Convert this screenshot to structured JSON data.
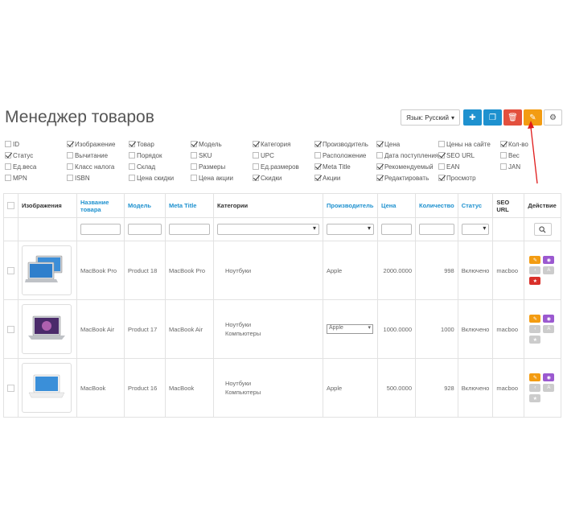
{
  "page": {
    "title": "Менеджер товаров"
  },
  "toolbar": {
    "language_label": "Язык: Русский"
  },
  "columns_options": [
    [
      {
        "label": "ID",
        "checked": false
      },
      {
        "label": "Изображение",
        "checked": true
      },
      {
        "label": "Товар",
        "checked": true
      },
      {
        "label": "Модель",
        "checked": true
      },
      {
        "label": "Категория",
        "checked": true
      },
      {
        "label": "Производитель",
        "checked": true
      },
      {
        "label": "Цена",
        "checked": true
      },
      {
        "label": "Цены на сайте",
        "checked": false
      },
      {
        "label": "Кол-во",
        "checked": true
      }
    ],
    [
      {
        "label": "Статус",
        "checked": true
      },
      {
        "label": "Вычитание",
        "checked": false
      },
      {
        "label": "Порядок",
        "checked": false
      },
      {
        "label": "SKU",
        "checked": false
      },
      {
        "label": "UPC",
        "checked": false
      },
      {
        "label": "Расположение",
        "checked": false
      },
      {
        "label": "Дата поступления",
        "checked": false
      },
      {
        "label": "SEO URL",
        "checked": true
      },
      {
        "label": "Вес",
        "checked": false
      }
    ],
    [
      {
        "label": "Ед.веса",
        "checked": false
      },
      {
        "label": "Класс налога",
        "checked": false
      },
      {
        "label": "Склад",
        "checked": false
      },
      {
        "label": "Размеры",
        "checked": false
      },
      {
        "label": "Ед.размеров",
        "checked": false
      },
      {
        "label": "Meta Title",
        "checked": true
      },
      {
        "label": "Рекомендуемый",
        "checked": true
      },
      {
        "label": "EAN",
        "checked": false
      },
      {
        "label": "JAN",
        "checked": false
      }
    ],
    [
      {
        "label": "MPN",
        "checked": false
      },
      {
        "label": "ISBN",
        "checked": false
      },
      {
        "label": "Цена скидки",
        "checked": false
      },
      {
        "label": "Цена акции",
        "checked": false
      },
      {
        "label": "Скидки",
        "checked": true
      },
      {
        "label": "Акции",
        "checked": true
      },
      {
        "label": "Редактировать",
        "checked": true
      },
      {
        "label": "Просмотр",
        "checked": true
      },
      null
    ]
  ],
  "table": {
    "headers": {
      "image": "Изображения",
      "name": "Название товара",
      "model": "Модель",
      "meta_title": "Meta Title",
      "categories": "Категории",
      "manufacturer": "Производитель",
      "price": "Цена",
      "quantity": "Количество",
      "status": "Статус",
      "seo_url": "SEO URL",
      "action": "Действие"
    },
    "rows": [
      {
        "name": "MacBook Pro",
        "model": "Product 18",
        "meta_title": "MacBook Pro",
        "categories": [
          "Ноутбуки"
        ],
        "manufacturer": "Apple",
        "manufacturer_select": false,
        "price": "2000.0000",
        "quantity": "998",
        "status": "Включено",
        "seo_url": "macboo"
      },
      {
        "name": "MacBook Air",
        "model": "Product 17",
        "meta_title": "MacBook Air",
        "categories": [
          "Ноутбуки",
          "Компьютеры"
        ],
        "manufacturer": "Apple",
        "manufacturer_select": true,
        "price": "1000.0000",
        "quantity": "1000",
        "status": "Включено",
        "seo_url": "macboo"
      },
      {
        "name": "MacBook",
        "model": "Product 16",
        "meta_title": "MacBook",
        "categories": [
          "Ноутбуки",
          "Компьютеры"
        ],
        "manufacturer": "Apple",
        "manufacturer_select": false,
        "price": "500.0000",
        "quantity": "928",
        "status": "Включено",
        "seo_url": "macboo"
      }
    ]
  },
  "colors": {
    "accent": "#1e91cf",
    "danger": "#e3503e",
    "warning": "#f39c12",
    "purple": "#9b59d0",
    "success": "#3a9a3a"
  }
}
